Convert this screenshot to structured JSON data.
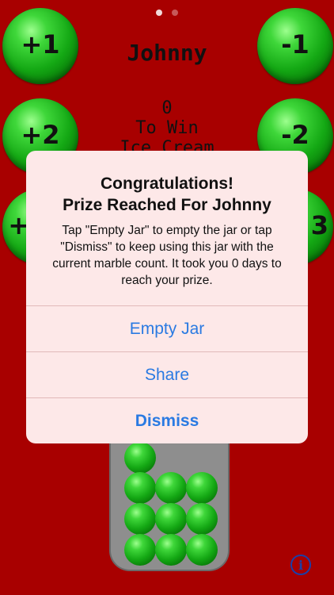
{
  "page_indicator": {
    "count": 2,
    "active_index": 0
  },
  "buttons": {
    "plus1": "+1",
    "minus1": "-1",
    "plus2": "+2",
    "minus2": "-2",
    "plus3_partial": "+",
    "minus3_partial": "3"
  },
  "jar": {
    "name": "Johnny",
    "count": "0",
    "goal_line1": "To Win",
    "goal_line2": "Ice Cream"
  },
  "alert": {
    "title_line1": "Congratulations!",
    "title_line2": "Prize Reached For Johnny",
    "message": "Tap \"Empty Jar\" to empty the jar or tap \"Dismiss\" to keep using this jar with the current marble count. It took you 0 days to reach your prize.",
    "actions": {
      "empty_jar": "Empty Jar",
      "share": "Share",
      "dismiss": "Dismiss"
    }
  },
  "info_button": {
    "glyph": "i"
  },
  "colors": {
    "background": "#a80000",
    "marble": "#14a814",
    "alert_bg": "#fde8e8",
    "alert_action": "#2a7ae2"
  }
}
